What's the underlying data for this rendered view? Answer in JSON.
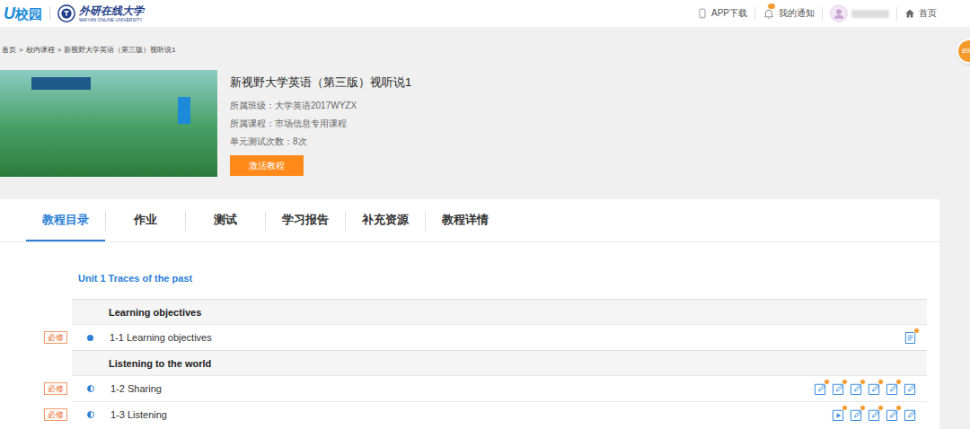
{
  "header": {
    "logo": {
      "mark": "U",
      "text": "校园"
    },
    "partner": {
      "name": "外研在线大学",
      "subtitle": "WAIYAN ONLINE UNIVERSITY"
    },
    "links": [
      {
        "kind": "app",
        "label": "APP下载"
      },
      {
        "kind": "notice",
        "label": "我的通知",
        "notification": true
      },
      {
        "kind": "user"
      },
      {
        "kind": "home",
        "label": "首页"
      }
    ],
    "float_badge": "89"
  },
  "breadcrumb": {
    "separator": ">",
    "items": [
      "首页",
      "校内课程",
      "新视野大学英语（第三版）视听说1"
    ]
  },
  "course": {
    "title": "新视野大学英语（第三版）视听说1",
    "details": [
      "所属班级：大学英语2017WYZX",
      "所属课程：市场信息专用课程",
      "单元测试次数：8次"
    ],
    "button": "激活教程"
  },
  "tabs": [
    {
      "label": "教程目录",
      "selected": true
    },
    {
      "label": "作业",
      "selected": false
    },
    {
      "label": "测试",
      "selected": false
    },
    {
      "label": "学习报告",
      "selected": false
    },
    {
      "label": "补充资源",
      "selected": false
    },
    {
      "label": "教程详情",
      "selected": false
    }
  ],
  "unit": {
    "title": "Unit 1 Traces of the past",
    "sections": [
      {
        "title": "Learning objectives",
        "items": [
          {
            "tag": "必修",
            "status": "complete",
            "title": "1-1 Learning objectives",
            "icons": [
              {
                "kind": "document",
                "badge": true
              }
            ]
          }
        ]
      },
      {
        "title": "Listening to the world",
        "items": [
          {
            "tag": "必修",
            "status": "partial",
            "title": "1-2 Sharing",
            "icons": [
              {
                "kind": "edit",
                "badge": true
              },
              {
                "kind": "edit",
                "badge": true
              },
              {
                "kind": "edit",
                "badge": true
              },
              {
                "kind": "edit",
                "badge": true
              },
              {
                "kind": "edit",
                "badge": true
              },
              {
                "kind": "edit",
                "badge": false
              }
            ]
          },
          {
            "tag": "必修",
            "status": "partial",
            "title": "1-3 Listening",
            "icons": [
              {
                "kind": "play",
                "badge": true
              },
              {
                "kind": "edit",
                "badge": true
              },
              {
                "kind": "edit",
                "badge": true
              },
              {
                "kind": "edit",
                "badge": true
              },
              {
                "kind": "edit",
                "badge": false
              }
            ]
          }
        ]
      }
    ]
  }
}
